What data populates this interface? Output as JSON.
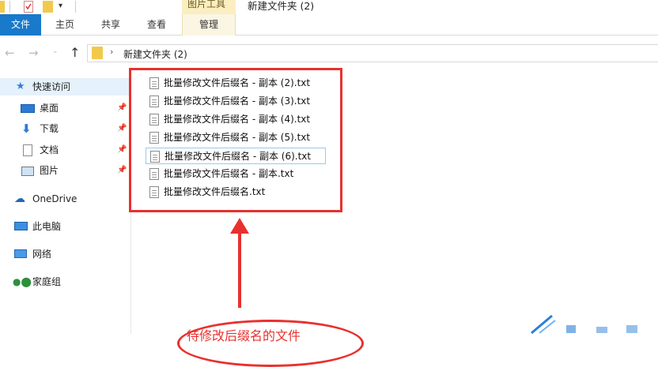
{
  "window": {
    "title": "新建文件夹 (2)",
    "context_tab_group": "图片工具"
  },
  "ribbon": {
    "tabs": [
      {
        "label": "文件"
      },
      {
        "label": "主页"
      },
      {
        "label": "共享"
      },
      {
        "label": "查看"
      },
      {
        "label": "管理"
      }
    ]
  },
  "address_bar": {
    "path": "新建文件夹 (2)"
  },
  "sidebar": {
    "quick_access": "快速访问",
    "items": [
      {
        "label": "桌面",
        "pinned": true
      },
      {
        "label": "下载",
        "pinned": true
      },
      {
        "label": "文档",
        "pinned": true
      },
      {
        "label": "图片",
        "pinned": true
      }
    ],
    "onedrive": "OneDrive",
    "this_pc": "此电脑",
    "network": "网络",
    "homegroup": "家庭组"
  },
  "files": [
    {
      "name": "批量修改文件后缀名 - 副本 (2).txt"
    },
    {
      "name": "批量修改文件后缀名 - 副本 (3).txt"
    },
    {
      "name": "批量修改文件后缀名 - 副本 (4).txt"
    },
    {
      "name": "批量修改文件后缀名 - 副本 (5).txt"
    },
    {
      "name": "批量修改文件后缀名 - 副本 (6).txt",
      "focused": true
    },
    {
      "name": "批量修改文件后缀名 - 副本.txt"
    },
    {
      "name": "批量修改文件后缀名.txt"
    }
  ],
  "annotation": {
    "text": "待修改后缀名的文件",
    "color": "#e8312e"
  },
  "colors": {
    "file_tab": "#1979ca",
    "context_tab": "#fbeec0",
    "annotation": "#e8312e"
  }
}
